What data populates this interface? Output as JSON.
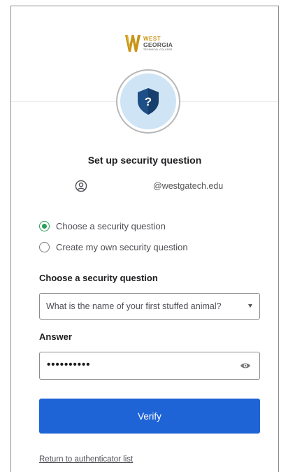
{
  "brand": {
    "line1": "WEST",
    "line2": "GEORGIA",
    "line3": "TECHNICAL COLLEGE",
    "gold": "#c89416"
  },
  "header": {
    "icon": "shield-question-icon",
    "icon_glyph": "?",
    "title": "Set up security question"
  },
  "user": {
    "icon": "user-icon",
    "email": "@westgatech.edu"
  },
  "options": [
    {
      "label": "Choose a security question",
      "checked": true
    },
    {
      "label": "Create my own security question",
      "checked": false
    }
  ],
  "question": {
    "label": "Choose a security question",
    "selected": "What is the name of your first stuffed animal?"
  },
  "answer": {
    "label": "Answer",
    "value": "••••••••••",
    "icon": "eye-icon"
  },
  "verify_label": "Verify",
  "return_link": "Return to authenticator list",
  "colors": {
    "primary": "#1f64d6",
    "radio_checked": "#2a9d59",
    "badge_bg": "#cfe4f5",
    "shield": "#1e4f86"
  }
}
